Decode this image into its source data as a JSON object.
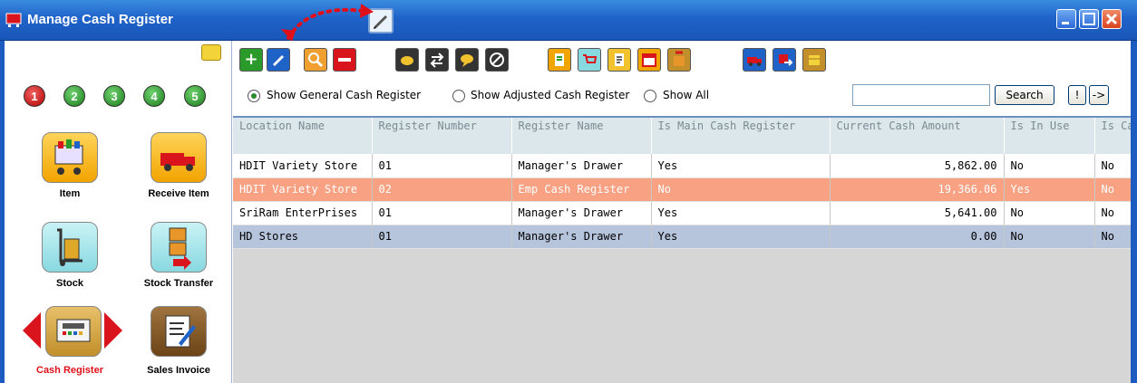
{
  "window": {
    "title": "Manage Cash Register"
  },
  "sidebar": {
    "steps": [
      "1",
      "2",
      "3",
      "4",
      "5"
    ],
    "nav": [
      {
        "label": "Item",
        "icon": "shopping-cart-icon"
      },
      {
        "label": "Receive Item",
        "icon": "truck-icon"
      },
      {
        "label": "Stock",
        "icon": "hand-truck-icon"
      },
      {
        "label": "Stock Transfer",
        "icon": "transfer-boxes-icon"
      },
      {
        "label": "Cash Register",
        "icon": "cash-register-icon"
      },
      {
        "label": "Sales Invoice",
        "icon": "invoice-pen-icon"
      }
    ]
  },
  "toolbar": {
    "buttons": [
      "add-icon",
      "edit-icon",
      "search-icon",
      "delete-icon",
      "coins-icon",
      "swap-icon",
      "chat-icon",
      "cancel-icon",
      "report-icon",
      "cart-icon",
      "receipt-icon",
      "calendar-icon",
      "package-icon",
      "truck-icon",
      "transfer-icon",
      "box-icon"
    ]
  },
  "filters": {
    "options": [
      "Show General Cash Register",
      "Show Adjusted Cash Register",
      "Show All"
    ],
    "selected": "Show General Cash Register"
  },
  "search": {
    "value": "",
    "button": "Search",
    "btn_excl": "!",
    "btn_arrow": "->"
  },
  "grid": {
    "columns": [
      "Location Name",
      "Register Number",
      "Register Name",
      "Is Main Cash Register",
      "Current Cash Amount",
      "Is In Use",
      "Is Ca"
    ],
    "rows": [
      [
        "HDIT Variety Store",
        "01",
        "Manager's Drawer",
        "Yes",
        "5,862.00",
        "No",
        "No"
      ],
      [
        "HDIT Variety Store",
        "02",
        "Emp Cash Register",
        "No",
        "19,366.06",
        "Yes",
        "No"
      ],
      [
        "SriRam EnterPrises",
        "01",
        "Manager's Drawer",
        "Yes",
        "5,641.00",
        "No",
        "No"
      ],
      [
        "HD Stores",
        "01",
        "Manager's Drawer",
        "Yes",
        "0.00",
        "No",
        "No"
      ]
    ],
    "selected_row": 1,
    "alt_row": 3
  },
  "colors": {
    "titlebar": "#1f63c9",
    "selected_row": "#f8a183",
    "alt_row": "#b6c4dc",
    "accent_red": "#d9141c"
  }
}
